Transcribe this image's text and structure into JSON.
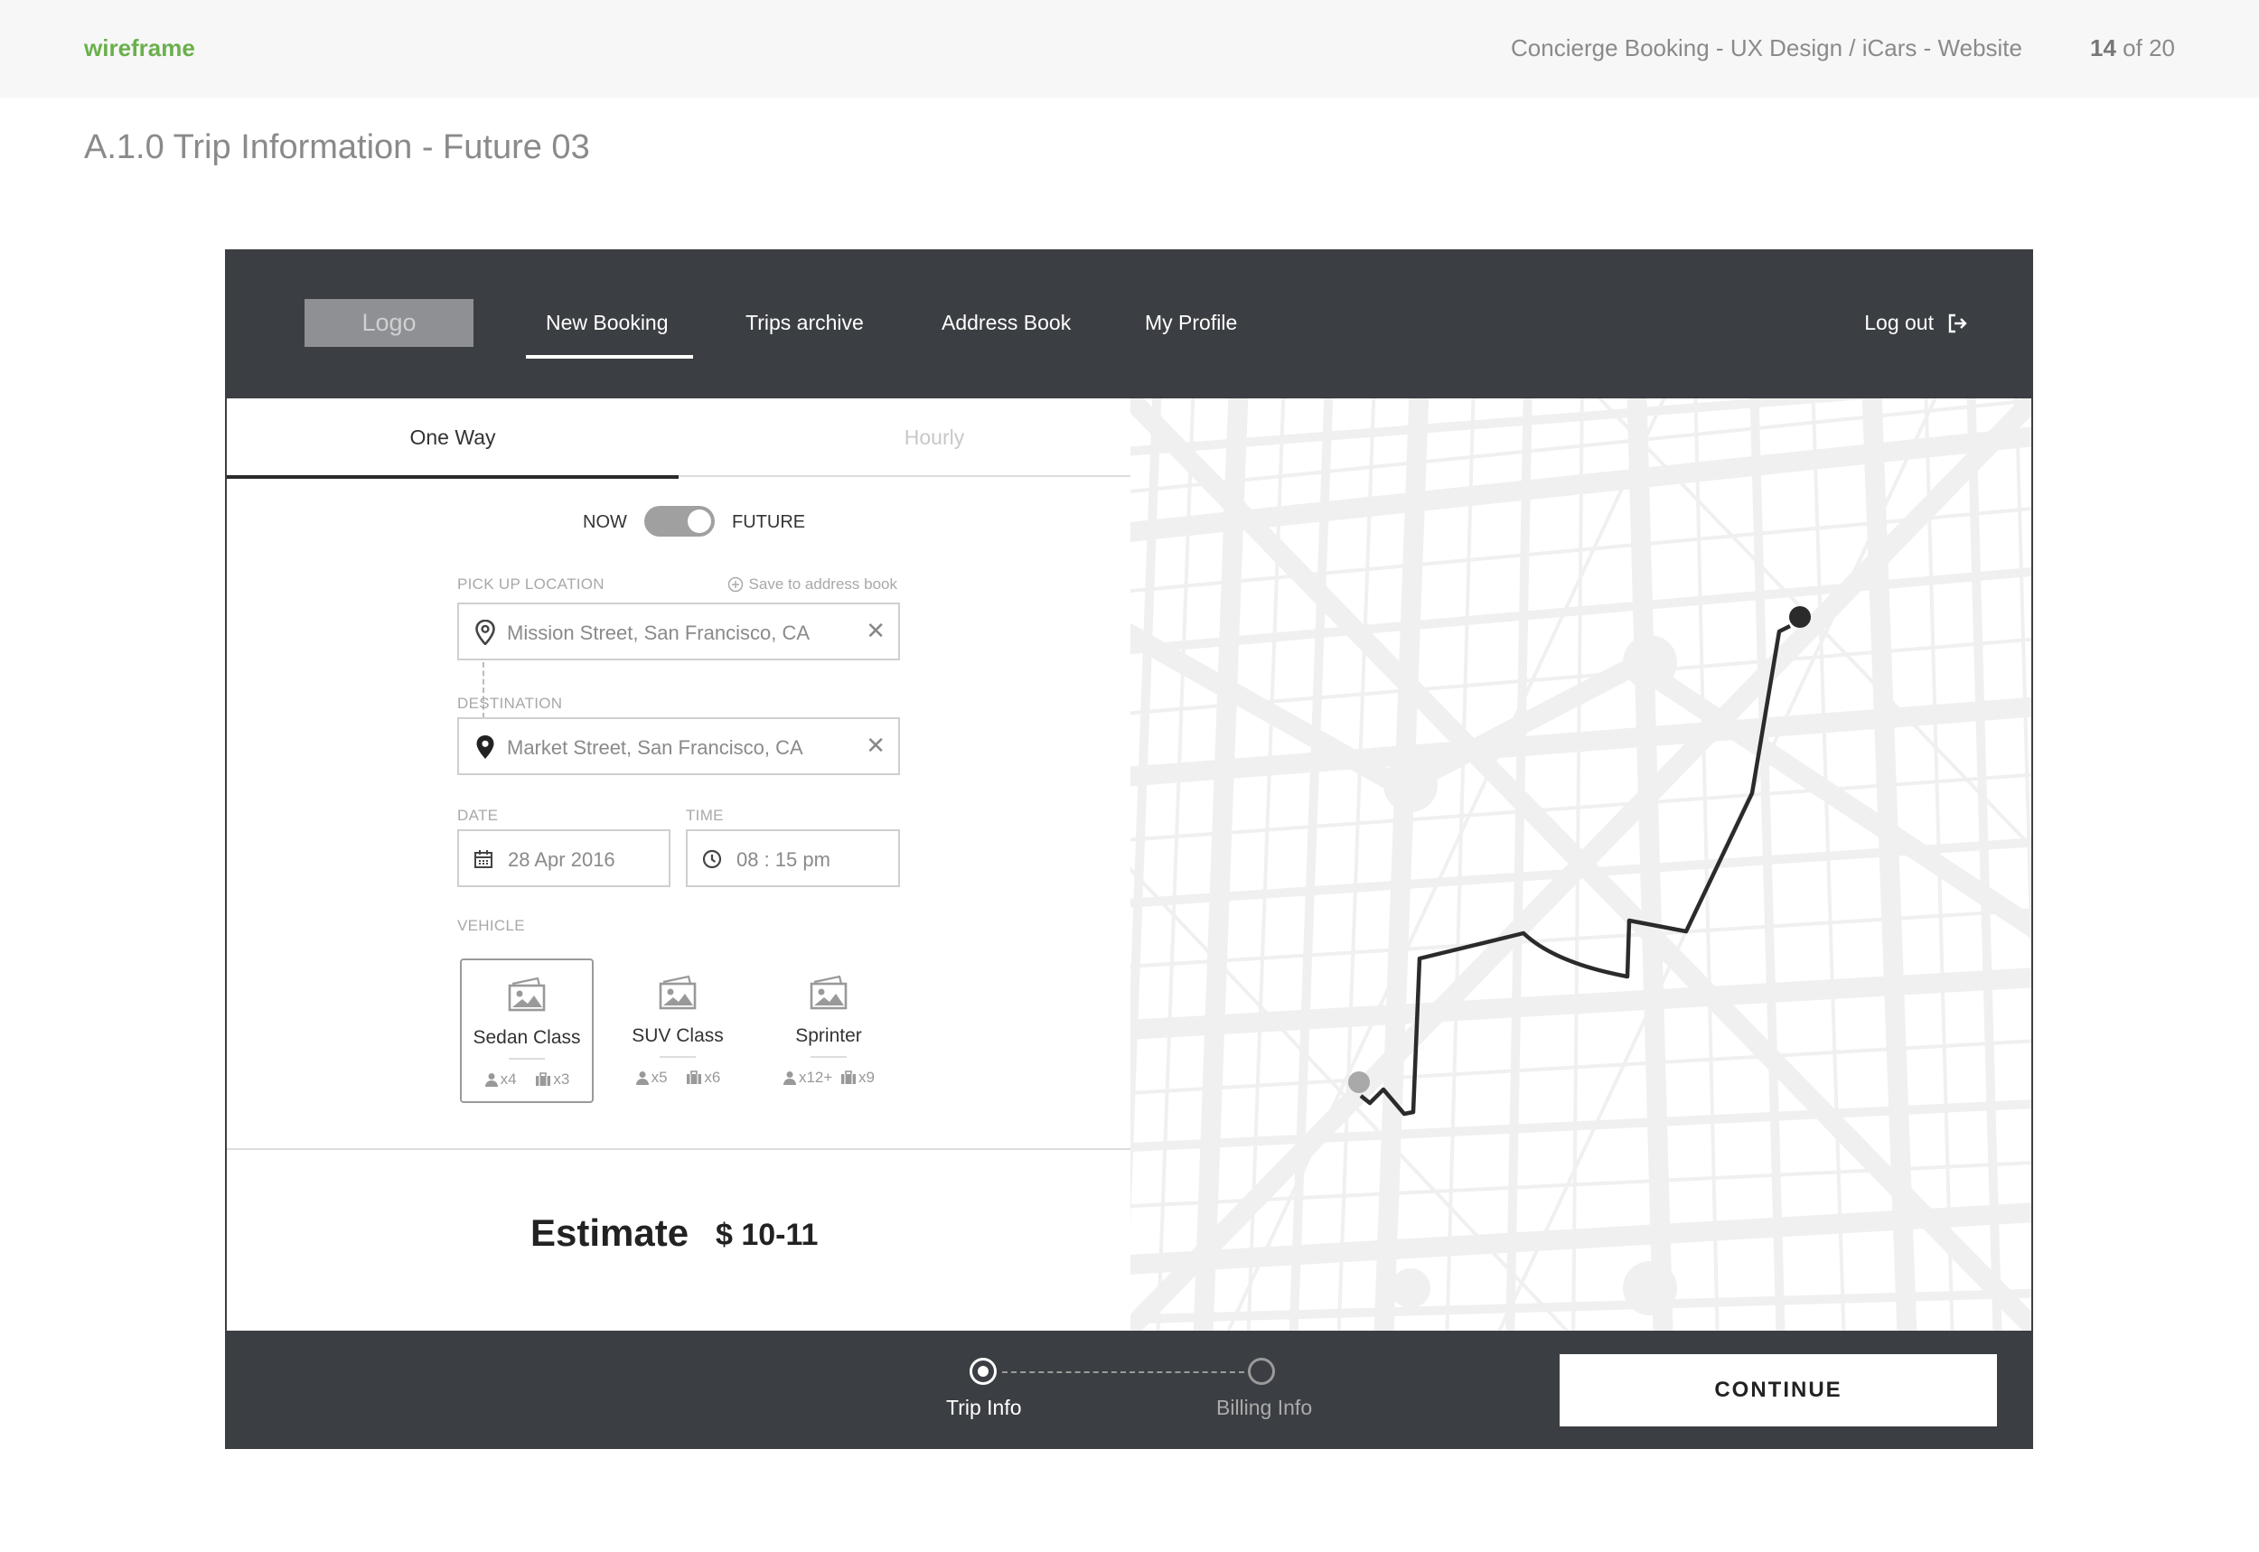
{
  "doc": {
    "brand": "wireframe",
    "project": "Concierge Booking - UX Design / iCars - Website",
    "page_current": "14",
    "page_sep": " of ",
    "page_total": "20",
    "title": "A.1.0 Trip Information - Future 03"
  },
  "nav": {
    "logo": "Logo",
    "items": [
      {
        "label": "New Booking",
        "active": true
      },
      {
        "label": "Trips archive"
      },
      {
        "label": "Address Book"
      },
      {
        "label": "My Profile"
      }
    ],
    "logout": "Log out"
  },
  "tabs": {
    "one_way": "One Way",
    "hourly": "Hourly"
  },
  "toggle": {
    "now": "NOW",
    "future": "FUTURE",
    "state": "future"
  },
  "pickup": {
    "label": "PICK UP LOCATION",
    "save": "Save to address book",
    "value": "Mission Street, San Francisco, CA"
  },
  "destination": {
    "label": "DESTINATION",
    "value": "Market Street, San Francisco, CA"
  },
  "date": {
    "label": "DATE",
    "value": "28 Apr 2016"
  },
  "time": {
    "label": "TIME",
    "value": "08 : 15 pm"
  },
  "vehicle": {
    "label": "VEHICLE",
    "options": [
      {
        "name": "Sedan Class",
        "passengers": "x4",
        "bags": "x3",
        "selected": true
      },
      {
        "name": "SUV Class",
        "passengers": "x5",
        "bags": "x6"
      },
      {
        "name": "Sprinter",
        "passengers": "x12+",
        "bags": "x9"
      }
    ]
  },
  "estimate": {
    "label": "Estimate",
    "value": "$ 10-11"
  },
  "steps": {
    "step1": "Trip Info",
    "step2": "Billing Info"
  },
  "continue": "CONTINUE",
  "icons": [
    "logout-icon",
    "plus-circle-icon",
    "location-pin-icon",
    "close-icon",
    "calendar-icon",
    "clock-icon",
    "image-icon",
    "person-icon",
    "luggage-icon"
  ]
}
